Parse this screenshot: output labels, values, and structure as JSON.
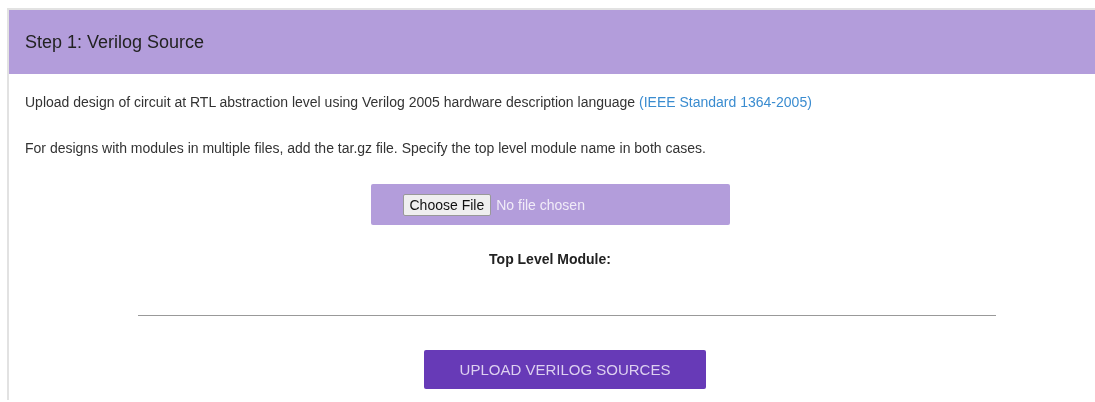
{
  "panel": {
    "title": "Step 1: Verilog Source",
    "paragraphs": [
      {
        "text": "Upload design of circuit at RTL abstraction level using Verilog 2005 hardware description language",
        "link": "(IEEE Standard 1364-2005)"
      },
      {
        "text": "For designs with modules in multiple files, add the tar.gz file. Specify the top level module name in both cases."
      }
    ],
    "file_input": {
      "button": "Choose File",
      "status": "No file chosen"
    },
    "field_label": "Top Level Module:",
    "submit": "UPLOAD VERILOG SOURCES"
  }
}
